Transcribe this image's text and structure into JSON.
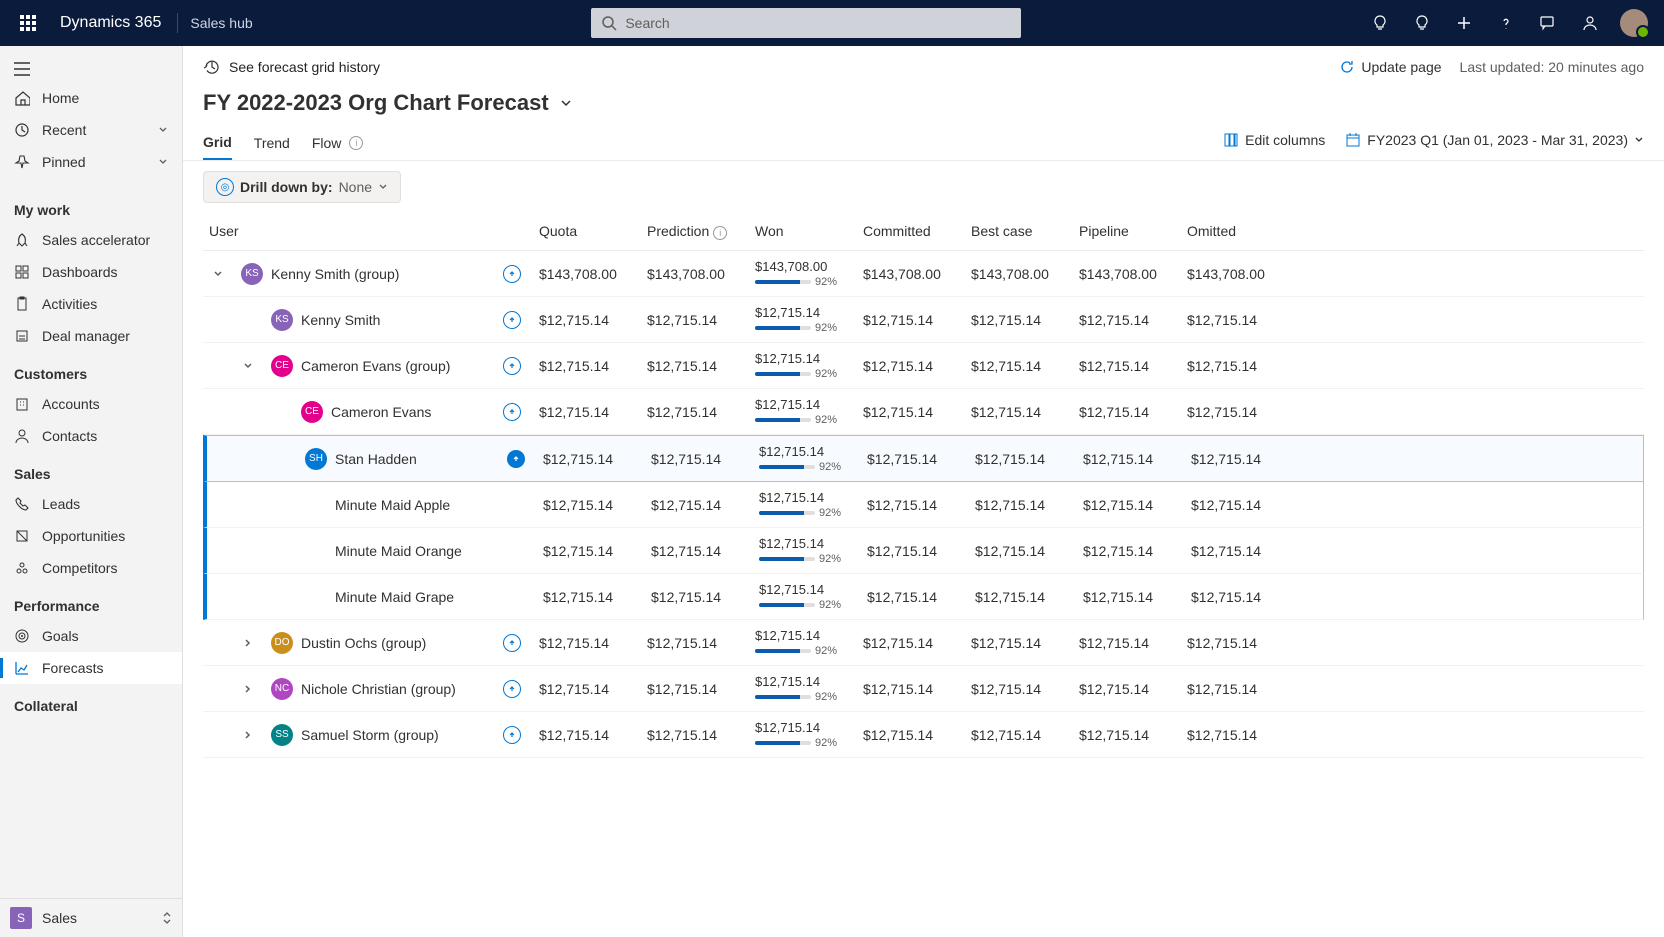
{
  "header": {
    "app_title": "Dynamics 365",
    "app_sub": "Sales hub",
    "search_placeholder": "Search"
  },
  "sidebar": {
    "top": [
      {
        "icon": "home",
        "label": "Home"
      },
      {
        "icon": "recent",
        "label": "Recent",
        "chev": true
      },
      {
        "icon": "pin",
        "label": "Pinned",
        "chev": true
      }
    ],
    "groups": [
      {
        "title": "My work",
        "items": [
          {
            "icon": "rocket",
            "label": "Sales accelerator"
          },
          {
            "icon": "dash",
            "label": "Dashboards"
          },
          {
            "icon": "clip",
            "label": "Activities"
          },
          {
            "icon": "deal",
            "label": "Deal manager"
          }
        ]
      },
      {
        "title": "Customers",
        "items": [
          {
            "icon": "building",
            "label": "Accounts"
          },
          {
            "icon": "person",
            "label": "Contacts"
          }
        ]
      },
      {
        "title": "Sales",
        "items": [
          {
            "icon": "phone",
            "label": "Leads"
          },
          {
            "icon": "opp",
            "label": "Opportunities"
          },
          {
            "icon": "comp",
            "label": "Competitors"
          }
        ]
      },
      {
        "title": "Performance",
        "items": [
          {
            "icon": "goal",
            "label": "Goals"
          },
          {
            "icon": "forecast",
            "label": "Forecasts",
            "active": true
          }
        ]
      },
      {
        "title": "Collateral",
        "items": []
      }
    ],
    "footer_label": "Sales",
    "footer_letter": "S"
  },
  "cmdbar": {
    "history": "See forecast grid history",
    "update": "Update page",
    "last_updated": "Last updated: 20 minutes ago"
  },
  "page_title": "FY 2022-2023 Org Chart Forecast",
  "tabs": [
    "Grid",
    "Trend",
    "Flow"
  ],
  "tabs_right": {
    "edit_cols": "Edit columns",
    "period": "FY2023 Q1 (Jan 01, 2023 - Mar 31, 2023)"
  },
  "drilldown": {
    "label": "Drill down by:",
    "value": "None"
  },
  "columns": [
    "User",
    "Quota",
    "Prediction",
    "Won",
    "Committed",
    "Best case",
    "Pipeline",
    "Omitted"
  ],
  "rows": [
    {
      "indent": 0,
      "expand": "down",
      "avatar": "KS",
      "color": "#8764b8",
      "name": "Kenny Smith (group)",
      "ind": "circ",
      "quota": "$143,708.00",
      "pred": "$143,708.00",
      "won": "$143,708.00",
      "pct": "92%",
      "committed": "$143,708.00",
      "best": "$143,708.00",
      "pipe": "$143,708.00",
      "omit": "$143,708.00"
    },
    {
      "indent": 1,
      "expand": "",
      "avatar": "KS",
      "color": "#8764b8",
      "name": "Kenny Smith",
      "ind": "circ",
      "quota": "$12,715.14",
      "pred": "$12,715.14",
      "won": "$12,715.14",
      "pct": "92%",
      "committed": "$12,715.14",
      "best": "$12,715.14",
      "pipe": "$12,715.14",
      "omit": "$12,715.14"
    },
    {
      "indent": 1,
      "expand": "down",
      "avatar": "CE",
      "color": "#e3008c",
      "name": "Cameron Evans (group)",
      "ind": "circ",
      "quota": "$12,715.14",
      "pred": "$12,715.14",
      "won": "$12,715.14",
      "pct": "92%",
      "committed": "$12,715.14",
      "best": "$12,715.14",
      "pipe": "$12,715.14",
      "omit": "$12,715.14"
    },
    {
      "indent": 2,
      "expand": "",
      "avatar": "CE",
      "color": "#e3008c",
      "name": "Cameron Evans",
      "ind": "circ",
      "quota": "$12,715.14",
      "pred": "$12,715.14",
      "won": "$12,715.14",
      "pct": "92%",
      "committed": "$12,715.14",
      "best": "$12,715.14",
      "pipe": "$12,715.14",
      "omit": "$12,715.14"
    },
    {
      "indent": 2,
      "expand": "",
      "avatar": "SH",
      "color": "#0078d4",
      "name": "Stan Hadden",
      "ind": "fill",
      "quota": "$12,715.14",
      "pred": "$12,715.14",
      "won": "$12,715.14",
      "pct": "92%",
      "committed": "$12,715.14",
      "best": "$12,715.14",
      "pipe": "$12,715.14",
      "omit": "$12,715.14",
      "sel": "head"
    },
    {
      "indent": 3,
      "expand": "",
      "avatar": "",
      "color": "",
      "name": "Minute Maid Apple",
      "ind": "",
      "quota": "$12,715.14",
      "pred": "$12,715.14",
      "won": "$12,715.14",
      "pct": "92%",
      "committed": "$12,715.14",
      "best": "$12,715.14",
      "pipe": "$12,715.14",
      "omit": "$12,715.14",
      "sel": "sub"
    },
    {
      "indent": 3,
      "expand": "",
      "avatar": "",
      "color": "",
      "name": "Minute Maid Orange",
      "ind": "",
      "quota": "$12,715.14",
      "pred": "$12,715.14",
      "won": "$12,715.14",
      "pct": "92%",
      "committed": "$12,715.14",
      "best": "$12,715.14",
      "pipe": "$12,715.14",
      "omit": "$12,715.14",
      "sel": "sub"
    },
    {
      "indent": 3,
      "expand": "",
      "avatar": "",
      "color": "",
      "name": "Minute Maid Grape",
      "ind": "",
      "quota": "$12,715.14",
      "pred": "$12,715.14",
      "won": "$12,715.14",
      "pct": "92%",
      "committed": "$12,715.14",
      "best": "$12,715.14",
      "pipe": "$12,715.14",
      "omit": "$12,715.14",
      "sel": "sub"
    },
    {
      "indent": 1,
      "expand": "right",
      "avatar": "DO",
      "color": "#ca8e1b",
      "name": "Dustin Ochs (group)",
      "ind": "circ",
      "quota": "$12,715.14",
      "pred": "$12,715.14",
      "won": "$12,715.14",
      "pct": "92%",
      "committed": "$12,715.14",
      "best": "$12,715.14",
      "pipe": "$12,715.14",
      "omit": "$12,715.14"
    },
    {
      "indent": 1,
      "expand": "right",
      "avatar": "NC",
      "color": "#b146c2",
      "name": "Nichole Christian (group)",
      "ind": "circ",
      "quota": "$12,715.14",
      "pred": "$12,715.14",
      "won": "$12,715.14",
      "pct": "92%",
      "committed": "$12,715.14",
      "best": "$12,715.14",
      "pipe": "$12,715.14",
      "omit": "$12,715.14"
    },
    {
      "indent": 1,
      "expand": "right",
      "avatar": "SS",
      "color": "#038387",
      "name": "Samuel Storm (group)",
      "ind": "circ",
      "quota": "$12,715.14",
      "pred": "$12,715.14",
      "won": "$12,715.14",
      "pct": "92%",
      "committed": "$12,715.14",
      "best": "$12,715.14",
      "pipe": "$12,715.14",
      "omit": "$12,715.14"
    }
  ]
}
